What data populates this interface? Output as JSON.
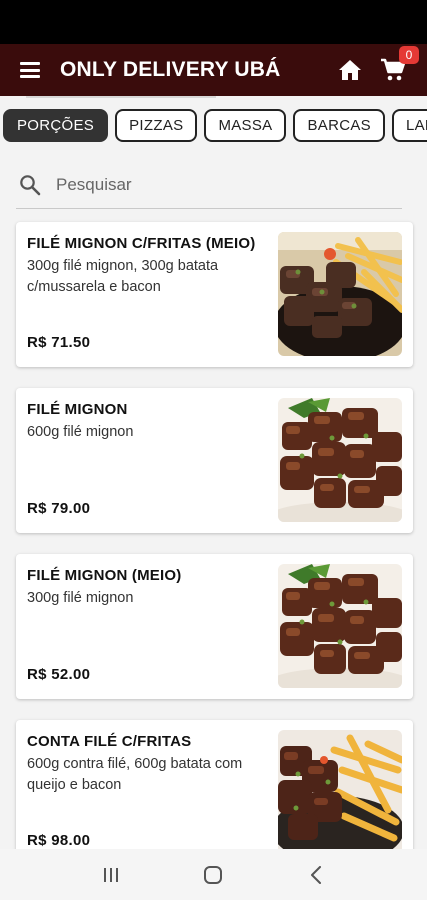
{
  "app": {
    "title": "ONLY DELIVERY UBÁ",
    "cart_count": "0",
    "brand_color": "#3a0c0c"
  },
  "categories": [
    {
      "label": "PORÇÕES",
      "active": true
    },
    {
      "label": "PIZZAS",
      "active": false
    },
    {
      "label": "MASSA",
      "active": false
    },
    {
      "label": "BARCAS",
      "active": false
    },
    {
      "label": "LANC",
      "active": false
    }
  ],
  "search": {
    "placeholder": "Pesquisar"
  },
  "products": [
    {
      "name": "FILÉ MIGNON C/FRITAS (MEIO)",
      "description": "300g filé mignon, 300g batata c/mussarela e bacon",
      "price": "R$ 71.50",
      "image": "steak-with-fries-photo"
    },
    {
      "name": "FILÉ MIGNON",
      "description": "600g filé mignon",
      "price": "R$ 79.00",
      "image": "steak-cubes-photo"
    },
    {
      "name": "FILÉ MIGNON (MEIO)",
      "description": "300g filé mignon",
      "price": "R$ 52.00",
      "image": "steak-cubes-photo"
    },
    {
      "name": "CONTA FILÉ C/FRITAS",
      "description": "600g contra filé, 600g batata com queijo e bacon",
      "price": "R$ 98.00",
      "image": "steak-with-fries-photo"
    }
  ],
  "icons": {
    "menu": "menu-icon",
    "home": "home-icon",
    "cart": "cart-icon",
    "search": "search-icon",
    "nav_recent": "recent-apps-icon",
    "nav_home": "nav-home-icon",
    "nav_back": "back-icon"
  }
}
